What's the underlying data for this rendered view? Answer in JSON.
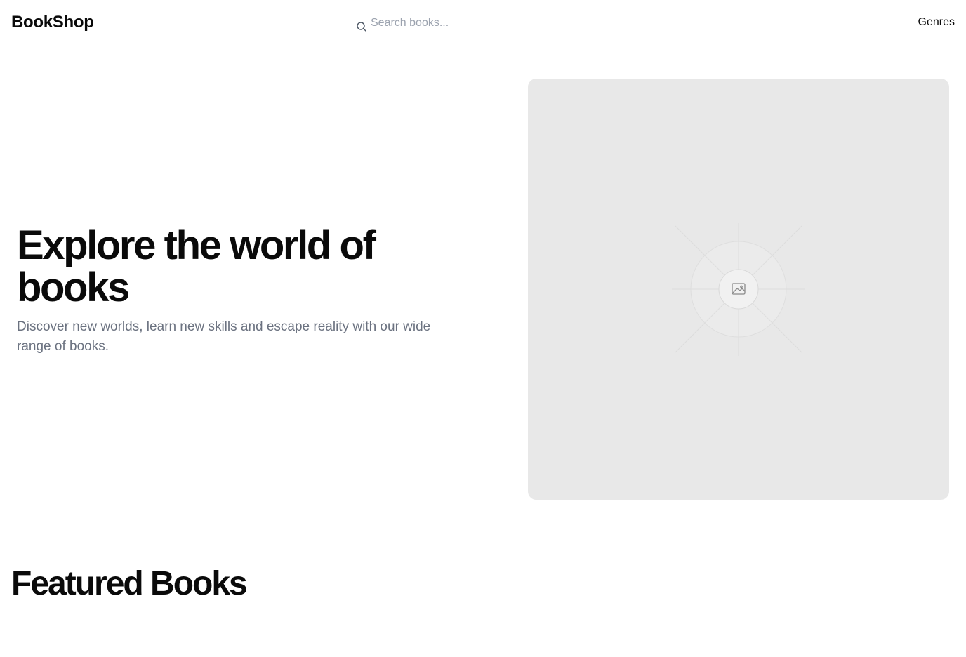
{
  "header": {
    "brand": "BookShop",
    "search": {
      "placeholder": "Search books...",
      "value": "",
      "icon": "search-icon"
    },
    "nav": {
      "genres_label": "Genres"
    }
  },
  "hero": {
    "title": "Explore the world of books",
    "subtitle": "Discover new worlds, learn new skills and escape reality with our wide range of books.",
    "image_icon": "image-placeholder-icon"
  },
  "featured": {
    "title": "Featured Books"
  },
  "colors": {
    "text": "#0a0a0a",
    "muted": "#6b7280",
    "placeholder_bg": "#e8e8e8"
  }
}
